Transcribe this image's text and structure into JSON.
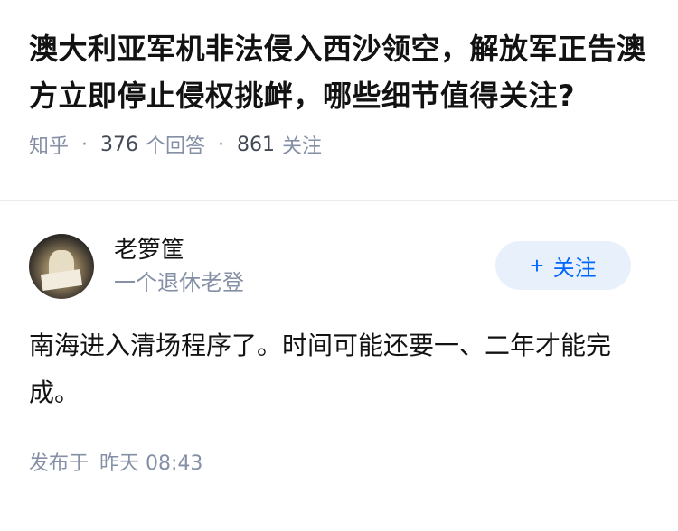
{
  "question": {
    "title": "澳大利亚军机非法侵入西沙领空，解放军正告澳方立即停止侵权挑衅，哪些细节值得关注?",
    "source": "知乎",
    "answer_count": "376",
    "answer_label": "个回答",
    "follow_count": "861",
    "follow_label": "关注"
  },
  "answer": {
    "author_name": "老箩筐",
    "author_desc": "一个退休老登",
    "follow_button": "关注",
    "content": "南海进入清场程序了。时间可能还要一、二年才能完成。",
    "published_label": "发布于",
    "published_time": "昨天 08:43"
  },
  "colors": {
    "accent": "#0066ff",
    "follow_bg": "#e8f1fb",
    "meta_gray": "#8590a6"
  },
  "icons": {
    "follow": "plus-icon"
  }
}
